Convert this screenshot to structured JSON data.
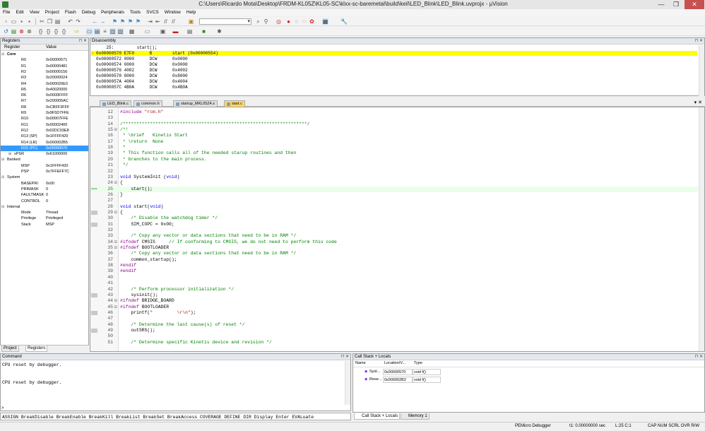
{
  "window": {
    "title": "C:\\Users\\Ricardo Mota\\Desktop\\FRDM-KL05Z\\KL05-SC\\klxx-sc-baremetal\\build\\keil\\LED_Blink\\LED_Blink.uvprojx - µVision",
    "min": "—",
    "max": "❐",
    "close": "✕"
  },
  "menu": [
    "File",
    "Edit",
    "View",
    "Project",
    "Flash",
    "Debug",
    "Peripherals",
    "Tools",
    "SVCS",
    "Window",
    "Help"
  ],
  "registers": {
    "title": "Registers",
    "col_register": "Register",
    "col_value": "Value",
    "rows": [
      {
        "name": "Core",
        "value": "",
        "level": 0,
        "exp": "⊟",
        "bold": true
      },
      {
        "name": "R0",
        "value": "0x00000571",
        "level": 2
      },
      {
        "name": "R1",
        "value": "0x00000481",
        "level": 2
      },
      {
        "name": "R2",
        "value": "0x00000156",
        "level": 2
      },
      {
        "name": "R3",
        "value": "0x20000024",
        "level": 2
      },
      {
        "name": "R4",
        "value": "0x000026E0",
        "level": 2
      },
      {
        "name": "R5",
        "value": "0x40020000",
        "level": 2
      },
      {
        "name": "R6",
        "value": "0x0000FFFF",
        "level": 2
      },
      {
        "name": "R7",
        "value": "0x200005AC",
        "level": 2
      },
      {
        "name": "R8",
        "value": "0xCBFF3FFF",
        "level": 2
      },
      {
        "name": "R9",
        "value": "0x9F5D7FFE",
        "level": 2
      },
      {
        "name": "R10",
        "value": "0x00007FFE",
        "level": 2
      },
      {
        "name": "R11",
        "value": "0x00002400",
        "level": 2
      },
      {
        "name": "R12",
        "value": "0x02DC03E8",
        "level": 2
      },
      {
        "name": "R13 (SP)",
        "value": "0x1FFFF420",
        "level": 2
      },
      {
        "name": "R14 (LR)",
        "value": "0x000002B5",
        "level": 2
      },
      {
        "name": "R15 (PC)",
        "value": "0x00000570",
        "level": 2,
        "sel": true
      },
      {
        "name": "xPSR",
        "value": "0x61000000",
        "level": 1,
        "exp": "⊞"
      },
      {
        "name": "Banked",
        "value": "",
        "level": 0,
        "exp": "⊟"
      },
      {
        "name": "MSP",
        "value": "0x1FFFF420",
        "level": 2
      },
      {
        "name": "PSP",
        "value": "0x7FFEFF7C",
        "level": 2
      },
      {
        "name": "System",
        "value": "",
        "level": 0,
        "exp": "⊟"
      },
      {
        "name": "BASEPRI",
        "value": "0x00",
        "level": 2
      },
      {
        "name": "PRIMASK",
        "value": "0",
        "level": 2
      },
      {
        "name": "FAULTMASK",
        "value": "0",
        "level": 2
      },
      {
        "name": "CONTROL",
        "value": "0",
        "level": 2
      },
      {
        "name": "Internal",
        "value": "",
        "level": 0,
        "exp": "⊟"
      },
      {
        "name": "Mode",
        "value": "Thread",
        "level": 2
      },
      {
        "name": "Privilege",
        "value": "Privileged",
        "level": 2
      },
      {
        "name": "Stack",
        "value": "MSP",
        "level": 2
      }
    ],
    "tab_project": "Project",
    "tab_registers": "Registers"
  },
  "disassembly": {
    "title": "Disassembly",
    "lines": [
      "    25:         start();",
      "0x00000570 E7F0      B        start (0x00000554)",
      "0x00000572 0000      DCW      0x0000",
      "0x00000574 0000      DCW      0x0000",
      "0x00000576 4002      DCW      0x4002",
      "0x00000578 8000      DCW      0x8000",
      "0x0000057A 4004      DCW      0x4004",
      "0x0000057C 4B0A      DCW      0x4B0A"
    ]
  },
  "editor_tabs": [
    {
      "label": "LED_Blink.c",
      "active": false
    },
    {
      "label": "common.h",
      "active": false
    },
    {
      "label": "startup_MKL05Z4.s",
      "active": false
    },
    {
      "label": "start.c",
      "active": true
    }
  ],
  "code": [
    {
      "ln": "12",
      "html": "<span class='c-pp'>#include</span> <span class='c-str'>\"rcm.h\"</span>"
    },
    {
      "ln": "13",
      "html": ""
    },
    {
      "ln": "14",
      "html": "<span class='c-com'>/********************************************************************/</span>"
    },
    {
      "ln": "15",
      "fold": "⊟",
      "html": "<span class='c-com'>/*!</span>"
    },
    {
      "ln": "16",
      "html": "<span class='c-com'> * \\brief   Kinetis Start</span>"
    },
    {
      "ln": "17",
      "html": "<span class='c-com'> * \\return  None</span>"
    },
    {
      "ln": "18",
      "html": "<span class='c-com'> *</span>"
    },
    {
      "ln": "19",
      "html": "<span class='c-com'> * This function calls all of the needed starup routines and then</span>"
    },
    {
      "ln": "20",
      "html": "<span class='c-com'> * branches to the main process.</span>"
    },
    {
      "ln": "21",
      "html": "<span class='c-com'> */</span>"
    },
    {
      "ln": "22",
      "html": ""
    },
    {
      "ln": "23",
      "html": "<span class='c-kw'>void</span> SystemInit (<span class='c-kw'>void</span>)"
    },
    {
      "ln": "24",
      "fold": "⊟",
      "html": "{"
    },
    {
      "ln": "25",
      "cur": true,
      "html": "    start();"
    },
    {
      "ln": "26",
      "html": "}"
    },
    {
      "ln": "27",
      "html": ""
    },
    {
      "ln": "28",
      "html": "<span class='c-kw'>void</span> start(<span class='c-kw'>void</span>)"
    },
    {
      "ln": "29",
      "fold": "⊟",
      "bp": true,
      "html": "{"
    },
    {
      "ln": "30",
      "html": "    <span class='c-com'>/* Disable the watchdog timer */</span>"
    },
    {
      "ln": "31",
      "bp": true,
      "html": "    SIM_COPC = 0x00;"
    },
    {
      "ln": "32",
      "html": ""
    },
    {
      "ln": "33",
      "html": "    <span class='c-com'>/* Copy any vector or data sections that need to be in RAM */</span>"
    },
    {
      "ln": "34",
      "fold": "⊟",
      "html": "<span class='c-pp'>#ifndef</span> CMSIS     <span class='c-com'>// If conforming to CMSIS, we do not need to perform this code</span>"
    },
    {
      "ln": "35",
      "fold": "⊟",
      "html": "<span class='c-pp'>#ifndef</span> BOOTLOADER"
    },
    {
      "ln": "36",
      "html": "    <span class='c-com'>/* Copy any vector or data sections that need to be in RAM */</span>"
    },
    {
      "ln": "37",
      "html": "    common_startup();"
    },
    {
      "ln": "38",
      "html": "<span class='c-pp'>#endif</span>"
    },
    {
      "ln": "39",
      "html": "<span class='c-pp'>#endif</span>"
    },
    {
      "ln": "40",
      "html": ""
    },
    {
      "ln": "41",
      "html": ""
    },
    {
      "ln": "42",
      "html": "    <span class='c-com'>/* Perform processor initialization */</span>"
    },
    {
      "ln": "43",
      "bp": true,
      "html": "    sysinit();"
    },
    {
      "ln": "44",
      "fold": "⊟",
      "html": "<span class='c-pp'>#ifndef</span> BRIDGE_BOARD"
    },
    {
      "ln": "45",
      "fold": "⊟",
      "html": "<span class='c-pp'>#ifndef</span> BOOTLOADER"
    },
    {
      "ln": "46",
      "bp": true,
      "html": "    printf(<span class='c-str'>\"         \\r\\n\"</span>);"
    },
    {
      "ln": "47",
      "html": ""
    },
    {
      "ln": "48",
      "html": "    <span class='c-com'>/* Determine the last cause(s) of reset */</span>"
    },
    {
      "ln": "49",
      "bp": true,
      "html": "    outSRS();"
    },
    {
      "ln": "50",
      "html": ""
    },
    {
      "ln": "51",
      "html": "    <span class='c-com'>/* Determine specific Kinetis device and revision */</span>"
    }
  ],
  "command": {
    "title": "Command",
    "lines": [
      "CPU reset by debugger.",
      "",
      "",
      "CPU reset by debugger."
    ],
    "prompt": ">",
    "assign": "ASSIGN BreakDisable BreakEnable BreakKill BreakList BreakSet BreakAccess COVERAGE DEFINE DIR Display Enter EVALuate"
  },
  "callstack": {
    "title": "Call Stack + Locals",
    "col_name": "Name",
    "col_location": "Location/V...",
    "col_type": "Type",
    "rows": [
      {
        "name": "Syst...",
        "location": "0x00000570",
        "type": "void f()"
      },
      {
        "name": "Rese...",
        "location": "0x000002B2",
        "type": "void f()"
      }
    ],
    "tab_callstack": "Call Stack + Locals",
    "tab_memory": "Memory 1"
  },
  "status": {
    "debugger": "PEMicro Debugger",
    "time": "t1: 0.00000000 sec",
    "cursor": "L:25 C:1",
    "indicators": "CAP  NUM  SCRL  OVR  R/W"
  },
  "accent": {
    "current_line": "#ffff00",
    "pc_highlight": "#3399ff",
    "active_tab": "#ffd966"
  }
}
